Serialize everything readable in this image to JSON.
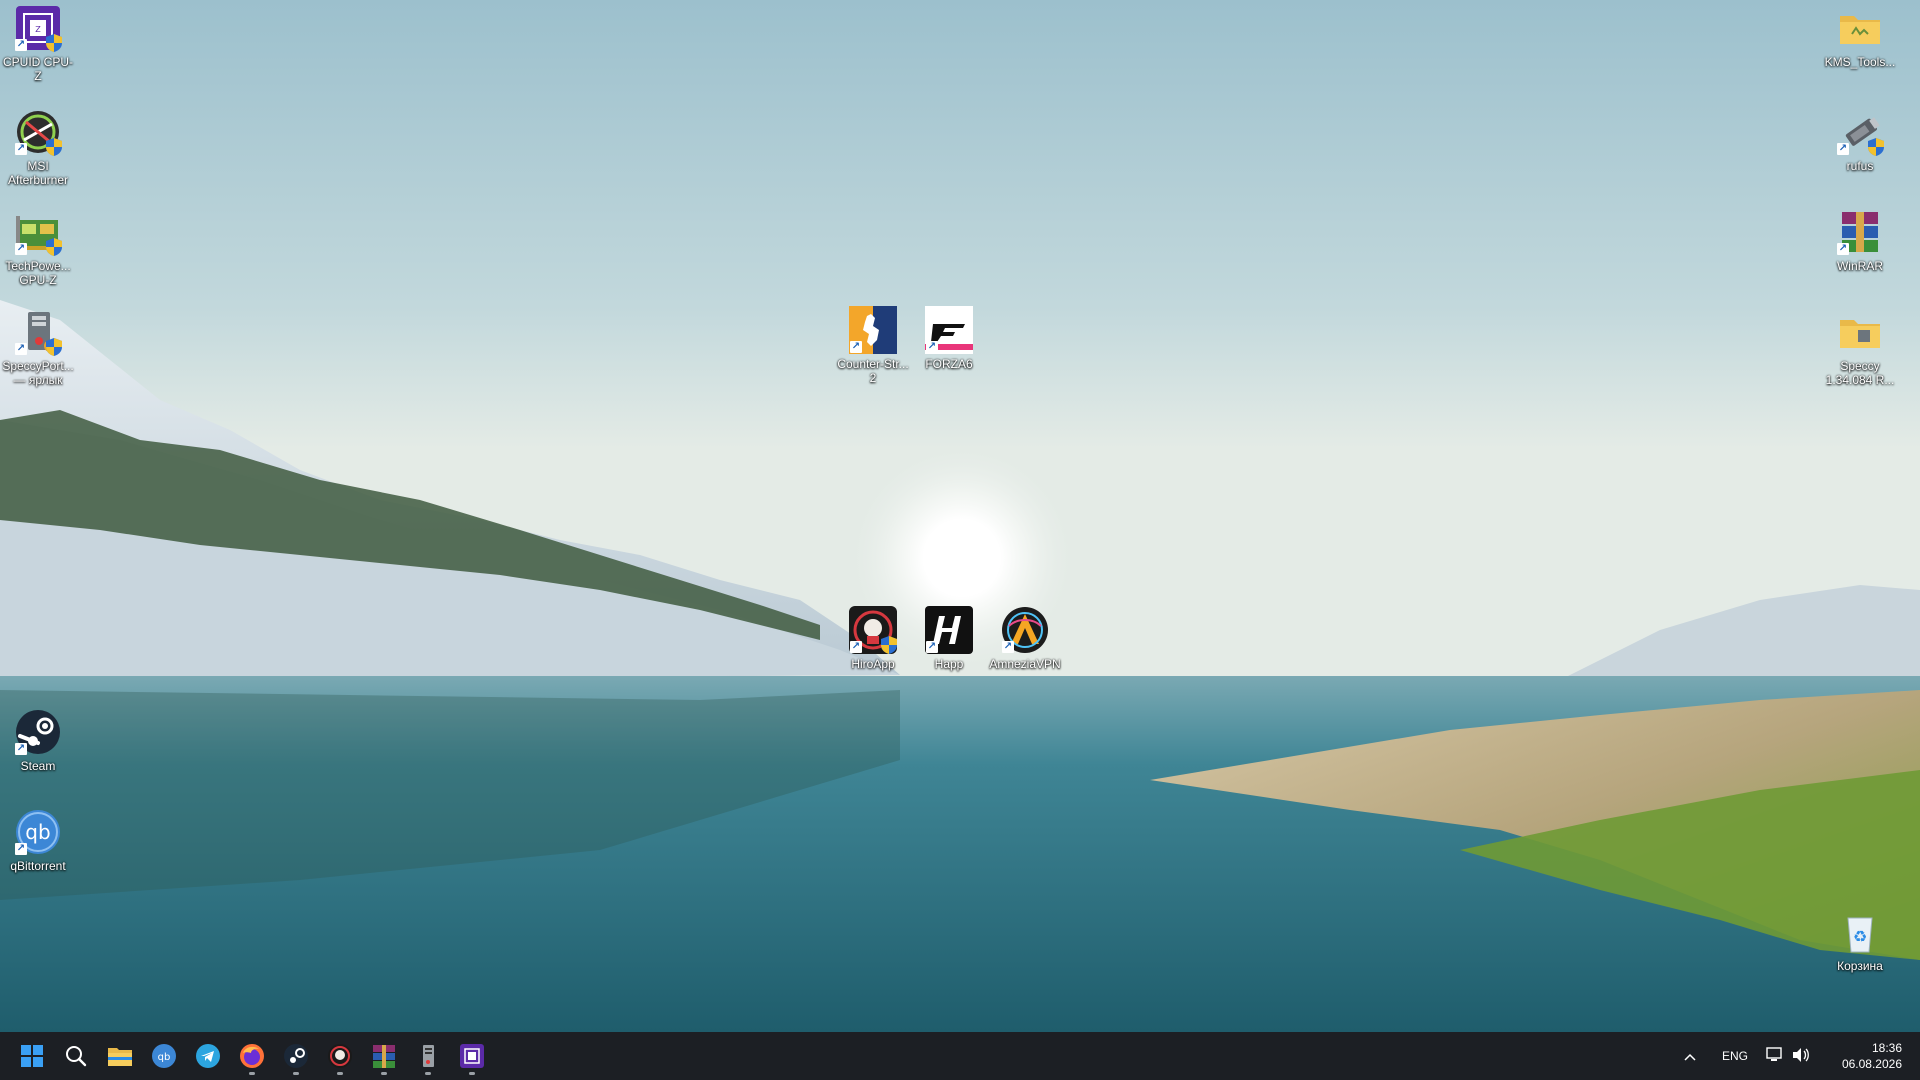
{
  "desktop": {
    "left_column": [
      {
        "id": "cpuz",
        "label": "CPUID CPU-Z",
        "icon": "cpu-z-icon"
      },
      {
        "id": "msi",
        "label": "MSI Afterburner",
        "icon": "msi-afterburner-icon"
      },
      {
        "id": "gpuz",
        "label": "TechPowe... GPU-Z",
        "icon": "gpu-z-icon"
      },
      {
        "id": "speccyport",
        "label": "SpeccyPort... — ярлык",
        "icon": "speccy-portable-icon"
      },
      {
        "id": "steam",
        "label": "Steam",
        "icon": "steam-icon"
      },
      {
        "id": "qbit",
        "label": "qBittorrent",
        "icon": "qbittorrent-icon"
      }
    ],
    "center_top": [
      {
        "id": "cs2",
        "label": "Counter-Str... 2",
        "icon": "counter-strike-icon"
      },
      {
        "id": "forza",
        "label": "FORZA6",
        "icon": "forza-icon"
      }
    ],
    "center_mid": [
      {
        "id": "hiro",
        "label": "HiroApp",
        "icon": "hiroapp-icon"
      },
      {
        "id": "happ",
        "label": "Happ",
        "icon": "happ-icon"
      },
      {
        "id": "amnezia",
        "label": "AmneziaVPN",
        "icon": "amnezia-vpn-icon"
      }
    ],
    "right_column": [
      {
        "id": "kms",
        "label": "KMS_Tools...",
        "icon": "folder-icon"
      },
      {
        "id": "rufus",
        "label": "rufus",
        "icon": "rufus-icon"
      },
      {
        "id": "winrar",
        "label": "WinRAR",
        "icon": "winrar-icon"
      },
      {
        "id": "speccyfolder",
        "label": "Speccy 1.34.084 R...",
        "icon": "folder-icon"
      },
      {
        "id": "recycle",
        "label": "Корзина",
        "icon": "recycle-bin-icon"
      }
    ]
  },
  "taskbar": {
    "pinned": [
      {
        "id": "start",
        "icon": "windows-start-icon",
        "running": false
      },
      {
        "id": "search",
        "icon": "search-icon",
        "running": false
      },
      {
        "id": "explorer",
        "icon": "file-explorer-icon",
        "running": false
      },
      {
        "id": "qbittorrent",
        "icon": "qbittorrent-icon",
        "running": false
      },
      {
        "id": "telegram",
        "icon": "telegram-icon",
        "running": false
      },
      {
        "id": "firefox",
        "icon": "firefox-icon",
        "running": true
      },
      {
        "id": "steam",
        "icon": "steam-icon",
        "running": true
      },
      {
        "id": "hiroapp",
        "icon": "hiroapp-icon",
        "running": true
      },
      {
        "id": "winrar",
        "icon": "winrar-icon",
        "running": true
      },
      {
        "id": "speccy",
        "icon": "speccy-icon",
        "running": true
      },
      {
        "id": "cpuz",
        "icon": "cpu-z-icon",
        "running": true
      }
    ],
    "tray": {
      "chevron": "^",
      "language": "ENG",
      "time": "18:36",
      "date": "06.08.2026"
    }
  },
  "colors": {
    "taskbar_bg": "#1c1f24",
    "accent": "#2b8ce6"
  }
}
